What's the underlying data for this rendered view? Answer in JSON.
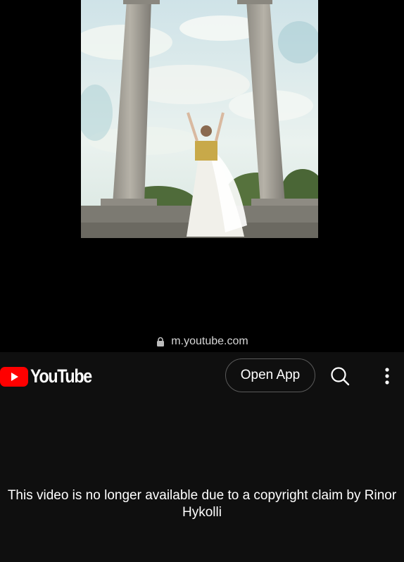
{
  "browser": {
    "url": "m.youtube.com",
    "lock_icon": "lock-icon"
  },
  "header": {
    "logo_text": "YouTube",
    "open_app_label": "Open App",
    "search_icon": "search-icon",
    "menu_icon": "more-vertical-icon"
  },
  "player": {
    "thumbnail": "woman-in-white-dress-between-columns"
  },
  "main": {
    "message": "This video is no longer available due to a copyright claim by Rinor Hykolli"
  },
  "colors": {
    "brand_red": "#ff0000",
    "background": "#0f0f0f",
    "text": "#ffffff"
  }
}
